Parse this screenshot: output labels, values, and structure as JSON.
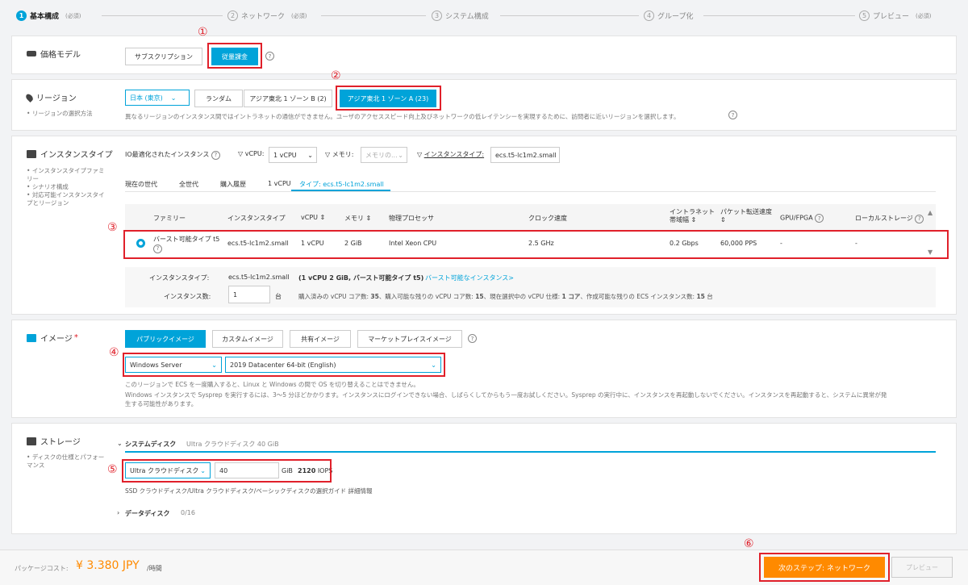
{
  "steps": [
    {
      "num": "1",
      "label": "基本構成",
      "req": "(必須)"
    },
    {
      "num": "2",
      "label": "ネットワーク",
      "req": "(必須)"
    },
    {
      "num": "3",
      "label": "システム構成",
      "req": ""
    },
    {
      "num": "4",
      "label": "グループ化",
      "req": ""
    },
    {
      "num": "5",
      "label": "プレビュー",
      "req": "(必須)"
    }
  ],
  "markers": {
    "m1": "①",
    "m2": "②",
    "m3": "③",
    "m4": "④",
    "m5": "⑤",
    "m6": "⑥"
  },
  "pricing": {
    "title": "価格モデル",
    "subscription": "サブスクリプション",
    "payg": "従量課金",
    "help": "?"
  },
  "region": {
    "title": "リージョン",
    "sub": "リージョンの選択方法",
    "bullet": "•",
    "select": "日本 (東京)",
    "random": "ランダム",
    "zone_b": "アジア東北 1 ゾーン B (2)",
    "zone_a": "アジア東北 1 ゾーン A (23)",
    "note": "異なるリージョンのインスタンス間ではイントラネットの通信ができません。ユーザのアクセススピード向上及びネットワークの低レイテンシーを実現するために、訪問者に近いリージョンを選択します。",
    "help": "?"
  },
  "instance": {
    "title": "インスタンスタイプ",
    "subs": [
      "インスタンスタイプファミリー",
      "シナリオ構成",
      "対応可能インスタンスタイプとリージョン"
    ],
    "filter_io": "IO最適化されたインスタンス",
    "vcpu_label": "vCPU:",
    "vcpu_value": "1 vCPU",
    "mem_label": "メモリ:",
    "mem_value": "メモリの...",
    "type_label": "インスタンスタイプ:",
    "type_value": "ecs.t5-lc1m2.small",
    "tabs": [
      "現在の世代",
      "全世代",
      "購入履歴",
      "1 vCPU",
      "タイプ: ecs.t5-lc1m2.small"
    ],
    "headers": {
      "family": "ファミリー",
      "type": "インスタンスタイプ",
      "vcpu": "vCPU",
      "mem": "メモリ",
      "proc": "物理プロセッサ",
      "clock": "クロック速度",
      "intranet1": "イントラネット",
      "intranet2": "帯域幅",
      "pps": "パケット転送速度",
      "gpu": "GPU/FPGA",
      "local": "ローカルストレージ"
    },
    "row": {
      "family": "バースト可能タイプ t5",
      "type": "ecs.t5-lc1m2.small",
      "vcpu": "1 vCPU",
      "mem": "2 GiB",
      "proc": "Intel Xeon CPU",
      "clock": "2.5 GHz",
      "bandwidth": "0.2 Gbps",
      "pps": "60,000 PPS",
      "gpu": "-",
      "local": "-"
    },
    "summary_label": "インスタンスタイプ:",
    "summary_type": "ecs.t5-lc1m2.small",
    "summary_spec": "(1 vCPU 2 GiB, バースト可能タイプ t5)",
    "summary_link": "バースト可能なインスタンス>",
    "count_label": "インスタンス数:",
    "count_value": "1",
    "count_unit": "台",
    "count_note1": "購入済みの vCPU コア数: ",
    "count_v1": "35",
    "count_note2": "、購入可能な残りの vCPU コア数: ",
    "count_v2": "15",
    "count_note3": "、現在選択中の vCPU 仕様: ",
    "count_v3": "1 コア",
    "count_note4": "、作成可能な残りの ECS インスタンス数: ",
    "count_v4": "15",
    "count_note5": " 台"
  },
  "image": {
    "title": "イメージ",
    "star": "*",
    "tabs": [
      "パブリックイメージ",
      "カスタムイメージ",
      "共有イメージ",
      "マーケットプレイスイメージ"
    ],
    "os": "Windows Server",
    "version": "2019 Datacenter 64-bit (English)",
    "note1": "このリージョンで ECS を一度購入すると、Linux と Windows の間で OS を切り替えることはできません。",
    "note2": "Windows インスタンスで Sysprep を実行するには、3～5 分ほどかかります。インスタンスにログインできない場合、しばらくしてからもう一度お試しください。Sysprep の実行中に、インスタンスを再起動しないでください。インスタンスを再起動すると、システムに異常が発",
    "note3": "生する可能性があります。",
    "help": "?"
  },
  "storage": {
    "title": "ストレージ",
    "subs": [
      "ディスクの仕様とパフォーマンス"
    ],
    "sysdisk": "システムディスク",
    "sysdisk_desc": "Ultra クラウドディスク  40 GiB",
    "disk_type": "Ultra クラウドディスク",
    "size": "40",
    "unit": "GiB",
    "iops_val": "2120",
    "iops": "IOPS",
    "guide": "SSD クラウドディスク/Ultra クラウドディスク/ベーシックディスクの選択ガイド",
    "detail": "詳細情報",
    "datadisk": "データディスク",
    "datadisk_count": "0/16"
  },
  "footer": {
    "cost_label": "パッケージコスト:",
    "cost_value": "¥ 3.380 JPY",
    "cost_unit": "/時間",
    "next": "次のステップ: ネットワーク",
    "preview": "プレビュー"
  },
  "colors": {
    "accent": "#00a3d9",
    "red": "#e0202a",
    "orange": "#ff8a00"
  }
}
